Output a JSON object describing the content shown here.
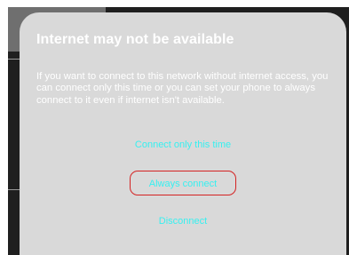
{
  "dialog": {
    "title": "Internet may not be available",
    "message": "If you want to connect to this network without internet access, you can connect only this time or you can set your phone to always connect to it even if internet isn't available.",
    "actions": {
      "connect_once": "Connect only this time",
      "always_connect": "Always connect",
      "disconnect": "Disconnect"
    }
  },
  "colors": {
    "dialog_bg": "#d9d9d9",
    "action_text": "#37f0f0",
    "highlight": "#d42323"
  }
}
